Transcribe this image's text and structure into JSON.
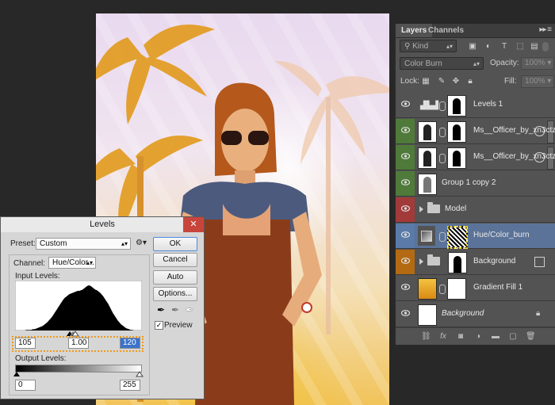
{
  "layers_panel": {
    "tabs": [
      "Layers",
      "Channels"
    ],
    "filter": {
      "kind_label": "Kind"
    },
    "blend_mode": "Color Burn",
    "opacity_label": "Opacity:",
    "opacity_value": "100%",
    "lock_label": "Lock:",
    "fill_label": "Fill:",
    "fill_value": "100%",
    "layers": [
      {
        "name": "Levels 1",
        "type": "adjustment",
        "color_label": "none"
      },
      {
        "name": "Ms__Officer_by_xn3ctz c...",
        "type": "smart-object",
        "color_label": "#4f7a3a"
      },
      {
        "name": "Ms__Officer_by_xn3ctz c...",
        "type": "smart-object",
        "color_label": "#4f7a3a"
      },
      {
        "name": "Group 1 copy 2",
        "type": "layer",
        "color_label": "#4f7a3a"
      },
      {
        "name": "Model",
        "type": "group",
        "color_label": "#a33a3a"
      },
      {
        "name": "Hue/Color_burn",
        "type": "adjustment",
        "color_label": "#5a7ba8",
        "selected": true
      },
      {
        "name": "Background",
        "type": "group",
        "color_label": "#b36a12"
      },
      {
        "name": "Gradient Fill 1",
        "type": "fill",
        "color_label": "none"
      },
      {
        "name": "Background",
        "type": "background",
        "color_label": "none",
        "locked": true
      }
    ]
  },
  "levels_dialog": {
    "title": "Levels",
    "preset_label": "Preset:",
    "preset_value": "Custom",
    "channel_label": "Channel:",
    "channel_value": "Hue/Color...",
    "input_levels_label": "Input Levels:",
    "input_black": "105",
    "input_gamma": "1.00",
    "input_white": "120",
    "output_levels_label": "Output Levels:",
    "output_black": "0",
    "output_white": "255",
    "buttons": {
      "ok": "OK",
      "cancel": "Cancel",
      "auto": "Auto",
      "options": "Options..."
    },
    "preview_label": "Preview",
    "preview_checked": true,
    "histogram": [
      0,
      0,
      0,
      0,
      0,
      0,
      0,
      1,
      1,
      1,
      1,
      2,
      2,
      3,
      4,
      5,
      6,
      7,
      9,
      11,
      13,
      16,
      19,
      22,
      26,
      30,
      34,
      38,
      42,
      46,
      50,
      53,
      55,
      57,
      59,
      60,
      61,
      62,
      63,
      64,
      64,
      65,
      66,
      68,
      70,
      72,
      73,
      72,
      70,
      68,
      66,
      65,
      63,
      61,
      58,
      55,
      51,
      47,
      43,
      38,
      33,
      28,
      24,
      20,
      16,
      13,
      10,
      8,
      6,
      4,
      3,
      2,
      1,
      1,
      0,
      0,
      0,
      0,
      0,
      0
    ]
  }
}
